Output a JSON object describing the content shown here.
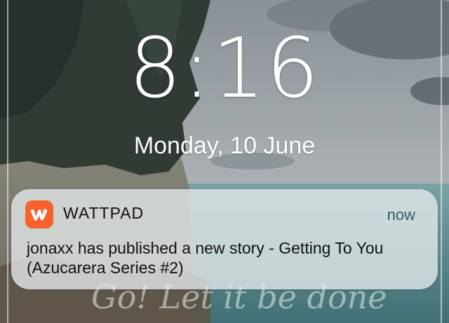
{
  "lock_screen": {
    "time": "8:16",
    "date": "Monday, 10 June"
  },
  "notification": {
    "app_icon": "wattpad-w-icon",
    "app_name": "WATTPAD",
    "time": "now",
    "message": "jonaxx has published a new story - Getting To You (Azucarera Series #2)",
    "accent_color": "#f6612e"
  },
  "wallpaper": {
    "script_text": "Go! Let it be done"
  }
}
